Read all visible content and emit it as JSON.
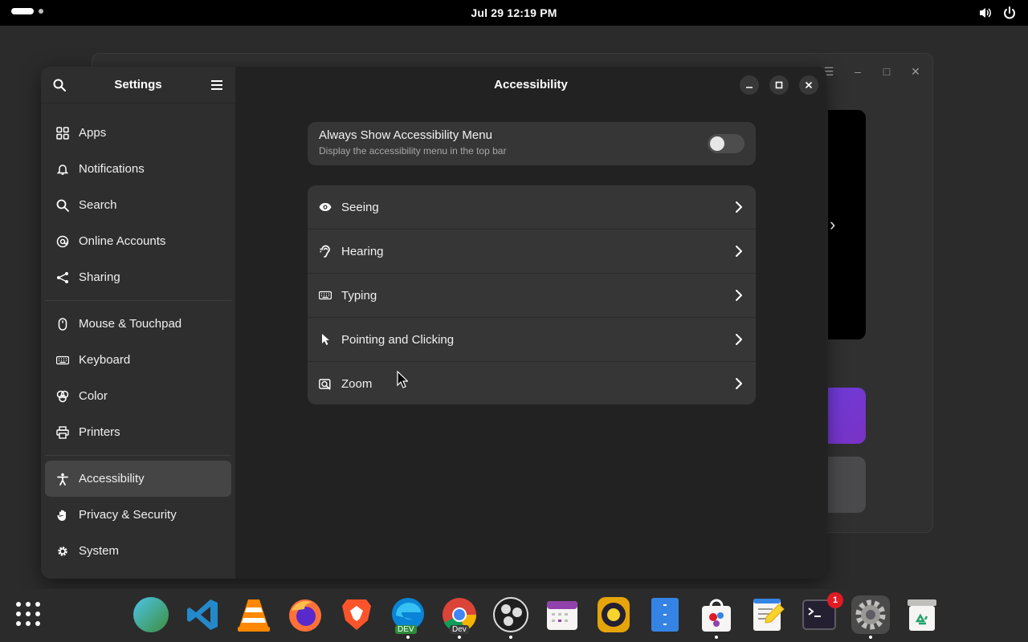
{
  "topbar": {
    "clock": "Jul 29  12:19 PM"
  },
  "sidebar": {
    "title": "Settings",
    "groups": [
      [
        {
          "label": "Apps",
          "icon": "apps-grid-icon"
        },
        {
          "label": "Notifications",
          "icon": "bell-icon"
        },
        {
          "label": "Search",
          "icon": "search-icon"
        },
        {
          "label": "Online Accounts",
          "icon": "at-icon"
        },
        {
          "label": "Sharing",
          "icon": "share-icon"
        }
      ],
      [
        {
          "label": "Mouse & Touchpad",
          "icon": "mouse-icon"
        },
        {
          "label": "Keyboard",
          "icon": "keyboard-icon"
        },
        {
          "label": "Color",
          "icon": "color-icon"
        },
        {
          "label": "Printers",
          "icon": "printer-icon"
        }
      ],
      [
        {
          "label": "Accessibility",
          "icon": "accessibility-icon",
          "active": true
        },
        {
          "label": "Privacy & Security",
          "icon": "hand-icon"
        },
        {
          "label": "System",
          "icon": "gear-icon"
        }
      ]
    ]
  },
  "content": {
    "title": "Accessibility",
    "toggle_card": {
      "title": "Always Show Accessibility Menu",
      "subtitle": "Display the accessibility menu in the top bar",
      "enabled": false
    },
    "rows": [
      {
        "label": "Seeing",
        "icon": "eye-icon"
      },
      {
        "label": "Hearing",
        "icon": "ear-icon"
      },
      {
        "label": "Typing",
        "icon": "keyboard-icon"
      },
      {
        "label": "Pointing and Clicking",
        "icon": "pointer-icon"
      },
      {
        "label": "Zoom",
        "icon": "zoom-icon"
      }
    ]
  },
  "dock": {
    "apps": [
      {
        "name": "browser-globe"
      },
      {
        "name": "vscode"
      },
      {
        "name": "vlc"
      },
      {
        "name": "firefox"
      },
      {
        "name": "brave"
      },
      {
        "name": "edge-dev",
        "tag": "DEV"
      },
      {
        "name": "chrome-dev",
        "tag": "Dev"
      },
      {
        "name": "obs"
      },
      {
        "name": "calendar"
      },
      {
        "name": "speaker"
      },
      {
        "name": "file-cabinet"
      },
      {
        "name": "software-store"
      },
      {
        "name": "text-editor"
      },
      {
        "name": "terminal",
        "badge": "1"
      },
      {
        "name": "settings",
        "active": true
      },
      {
        "name": "trash"
      }
    ]
  },
  "colors": {
    "accent": "#3584e4",
    "window_bg": "#222222",
    "sidebar_bg": "#2e2e2e",
    "card_bg": "#363636",
    "badge": "#e01b24"
  }
}
